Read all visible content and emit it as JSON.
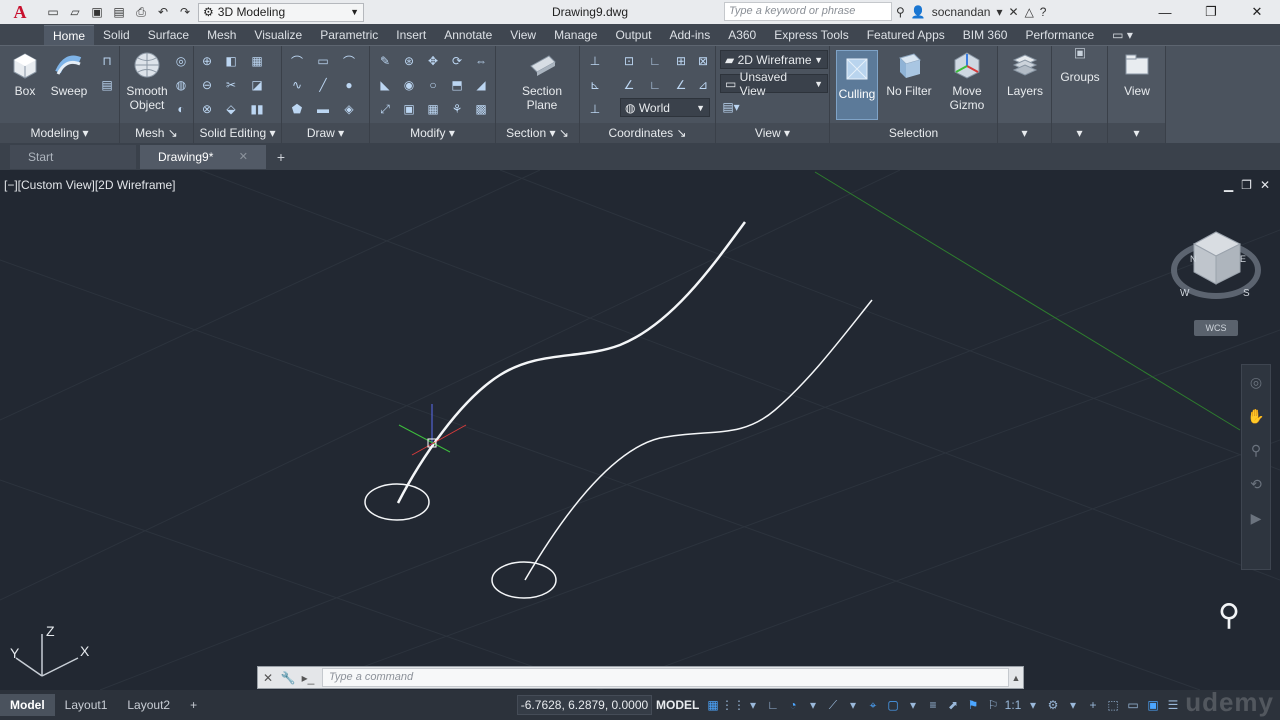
{
  "titlebar": {
    "logo": "A",
    "workspace": "3D Modeling",
    "document_title": "Drawing9.dwg",
    "search_placeholder": "Type a keyword or phrase",
    "username": "socnandan"
  },
  "ribbon_tabs": [
    "Home",
    "Solid",
    "Surface",
    "Mesh",
    "Visualize",
    "Parametric",
    "Insert",
    "Annotate",
    "View",
    "Manage",
    "Output",
    "Add-ins",
    "A360",
    "Express Tools",
    "Featured Apps",
    "BIM 360",
    "Performance"
  ],
  "ribbon": {
    "modeling": {
      "box": "Box",
      "sweep": "Sweep",
      "title": "Modeling"
    },
    "mesh": {
      "smooth_object": "Smooth Object",
      "title": "Mesh"
    },
    "solid_editing": {
      "title": "Solid Editing"
    },
    "draw": {
      "title": "Draw"
    },
    "modify": {
      "title": "Modify"
    },
    "section": {
      "section_plane": "Section Plane",
      "title": "Section"
    },
    "coordinates": {
      "world": "World",
      "title": "Coordinates"
    },
    "view": {
      "visual_style": "2D Wireframe",
      "named_view": "Unsaved View",
      "title": "View"
    },
    "selection": {
      "culling": "Culling",
      "no_filter": "No Filter",
      "move_gizmo": "Move Gizmo",
      "title": "Selection"
    },
    "layers": "Layers",
    "groups": "Groups",
    "view_panel": "View"
  },
  "file_tabs": [
    {
      "label": "Start"
    },
    {
      "label": "Drawing9*"
    }
  ],
  "viewport": {
    "label": "[−][Custom View][2D Wireframe]",
    "wcs": "WCS",
    "ucs": {
      "z": "Z",
      "y": "Y",
      "x": "X"
    }
  },
  "command_line": {
    "placeholder": "Type  a  command"
  },
  "layout_tabs": [
    "Model",
    "Layout1",
    "Layout2"
  ],
  "status": {
    "coordinates": "-6.7628, 6.2879, 0.0000",
    "space": "MODEL",
    "scale": "1:1"
  },
  "watermark": "udemy"
}
